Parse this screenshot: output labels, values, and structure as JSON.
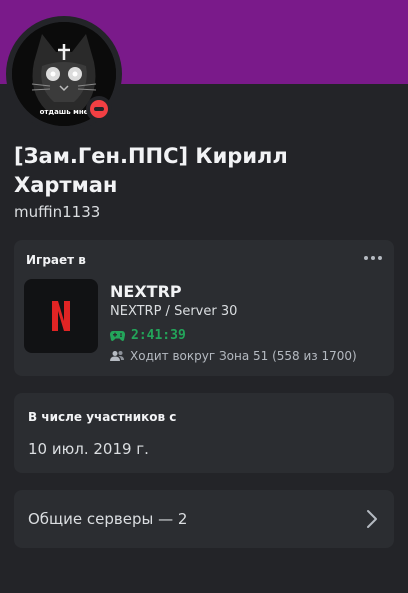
{
  "profile": {
    "avatar_caption": "отдашь мне",
    "display_name": "[Зам.Ген.ППС] Кирилл Хартман",
    "username": "muffin1133",
    "status": "dnd",
    "banner_color": "#7a1a8a",
    "status_color": "#f23f43"
  },
  "activity": {
    "section_title": "Играет в",
    "more_icon": "more-horizontal-icon",
    "game_name": "NEXTRP",
    "details": "NEXTRP / Server 30",
    "elapsed": "2:41:39",
    "party": "Ходит вокруг Зона 51 (558 из 1700)",
    "timer_color": "#23a55a"
  },
  "member_since": {
    "title": "В числе участников с",
    "date": "10 июл. 2019 г."
  },
  "mutual_servers": {
    "label": "Общие серверы — 2"
  }
}
